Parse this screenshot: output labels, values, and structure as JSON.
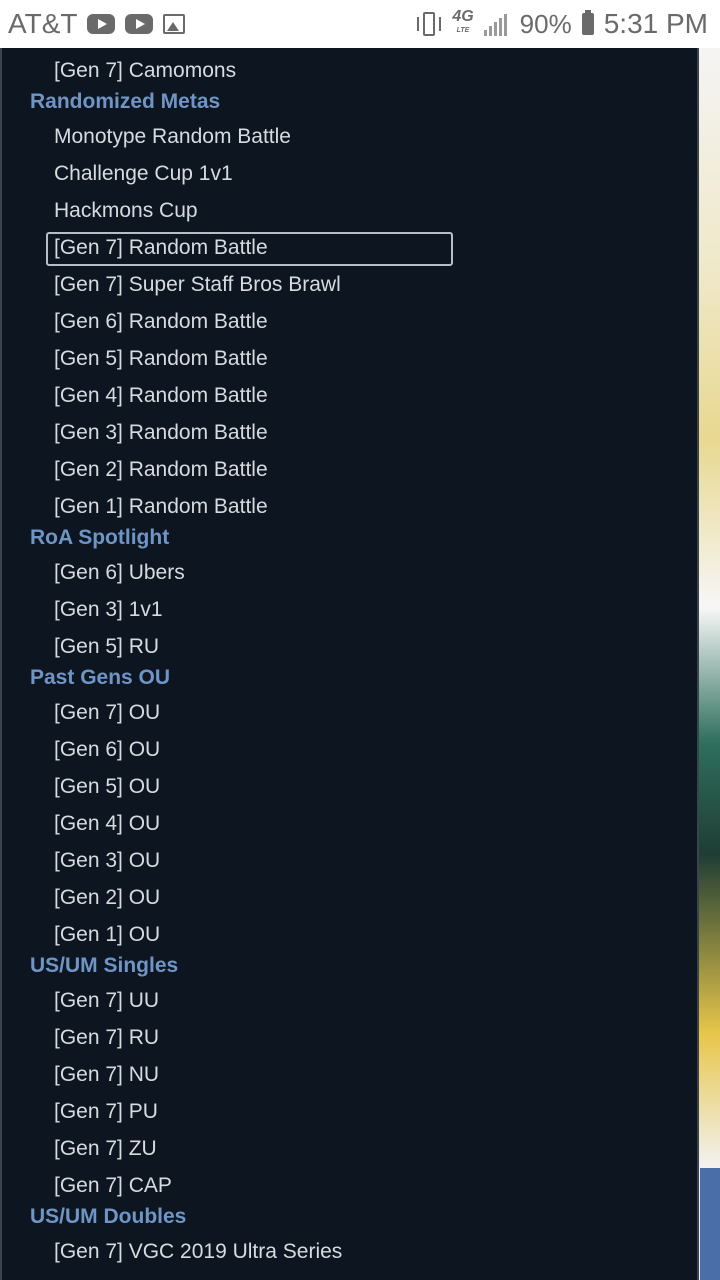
{
  "status_bar": {
    "carrier": "AT&T",
    "network": "4G",
    "network_sub": "LTE",
    "battery": "90%",
    "time": "5:31 PM",
    "icons": [
      "youtube-icon",
      "youtube-icon",
      "image-icon",
      "vibrate-icon",
      "lte-icon",
      "signal-icon",
      "battery-charging-icon"
    ]
  },
  "format_list": {
    "entries": [
      {
        "kind": "item",
        "label": "[Gen 7] Camomons"
      },
      {
        "kind": "group",
        "label": "Randomized Metas"
      },
      {
        "kind": "item",
        "label": "Monotype Random Battle"
      },
      {
        "kind": "item",
        "label": "Challenge Cup 1v1"
      },
      {
        "kind": "item",
        "label": "Hackmons Cup"
      },
      {
        "kind": "item",
        "label": "[Gen 7] Random Battle",
        "selected": true
      },
      {
        "kind": "item",
        "label": "[Gen 7] Super Staff Bros Brawl"
      },
      {
        "kind": "item",
        "label": "[Gen 6] Random Battle"
      },
      {
        "kind": "item",
        "label": "[Gen 5] Random Battle"
      },
      {
        "kind": "item",
        "label": "[Gen 4] Random Battle"
      },
      {
        "kind": "item",
        "label": "[Gen 3] Random Battle"
      },
      {
        "kind": "item",
        "label": "[Gen 2] Random Battle"
      },
      {
        "kind": "item",
        "label": "[Gen 1] Random Battle"
      },
      {
        "kind": "group",
        "label": "RoA Spotlight"
      },
      {
        "kind": "item",
        "label": "[Gen 6] Ubers"
      },
      {
        "kind": "item",
        "label": "[Gen 3] 1v1"
      },
      {
        "kind": "item",
        "label": "[Gen 5] RU"
      },
      {
        "kind": "group",
        "label": "Past Gens OU"
      },
      {
        "kind": "item",
        "label": "[Gen 7] OU"
      },
      {
        "kind": "item",
        "label": "[Gen 6] OU"
      },
      {
        "kind": "item",
        "label": "[Gen 5] OU"
      },
      {
        "kind": "item",
        "label": "[Gen 4] OU"
      },
      {
        "kind": "item",
        "label": "[Gen 3] OU"
      },
      {
        "kind": "item",
        "label": "[Gen 2] OU"
      },
      {
        "kind": "item",
        "label": "[Gen 1] OU"
      },
      {
        "kind": "group",
        "label": "US/UM Singles"
      },
      {
        "kind": "item",
        "label": "[Gen 7] UU"
      },
      {
        "kind": "item",
        "label": "[Gen 7] RU"
      },
      {
        "kind": "item",
        "label": "[Gen 7] NU"
      },
      {
        "kind": "item",
        "label": "[Gen 7] PU"
      },
      {
        "kind": "item",
        "label": "[Gen 7] ZU"
      },
      {
        "kind": "item",
        "label": "[Gen 7] CAP"
      },
      {
        "kind": "group",
        "label": "US/UM Doubles"
      },
      {
        "kind": "item",
        "label": "[Gen 7] VGC 2019 Ultra Series"
      }
    ]
  },
  "colors": {
    "panel_bg": "#0d1620",
    "item_text": "#d7dbe0",
    "group_text": "#6f95c6",
    "selected_border": "#b8bec6"
  }
}
